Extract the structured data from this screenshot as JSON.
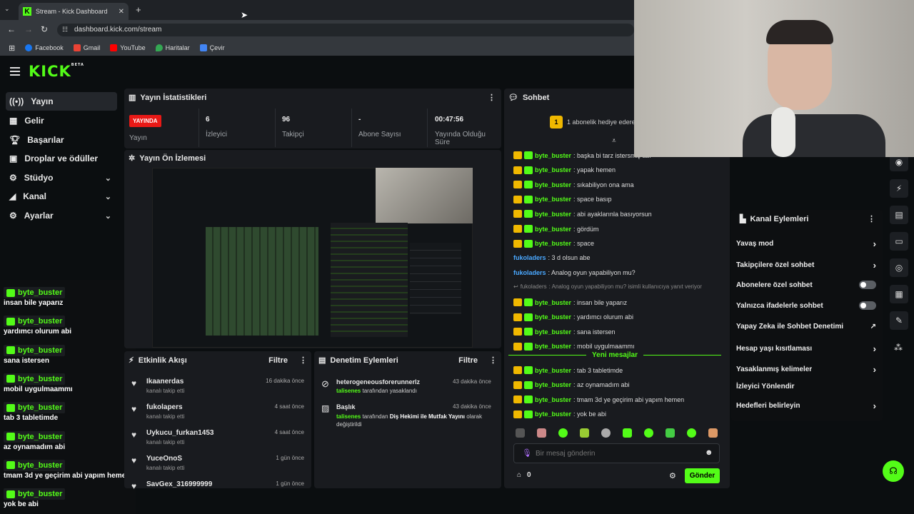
{
  "browser": {
    "tab_title": "Stream - Kick Dashboard",
    "url": "dashboard.kick.com/stream",
    "bookmarks": [
      "Facebook",
      "Gmail",
      "YouTube",
      "Haritalar",
      "Çevir"
    ]
  },
  "brand": {
    "logo": "KICK",
    "beta": "BETA"
  },
  "sidebar": {
    "items": [
      {
        "label": "Yayın"
      },
      {
        "label": "Gelir"
      },
      {
        "label": "Başarılar"
      },
      {
        "label": "Droplar ve ödüller"
      },
      {
        "label": "Stüdyo"
      },
      {
        "label": "Kanal"
      },
      {
        "label": "Ayarlar"
      }
    ]
  },
  "stats": {
    "title": "Yayın İstatistikleri",
    "live_badge": "YAYINDA",
    "live_label": "Yayın",
    "viewers_value": "6",
    "viewers_label": "İzleyici",
    "followers_value": "96",
    "followers_label": "Takipçi",
    "subs_value": "-",
    "subs_label": "Abone Sayısı",
    "duration_value": "00:47:56",
    "duration_label": "Yayında Olduğu Süre"
  },
  "preview": {
    "title": "Yayın Ön İzlemesi"
  },
  "activity": {
    "title": "Etkinlik Akışı",
    "filter": "Filtre",
    "rows": [
      {
        "name": "Ikaanerdas",
        "sub": "kanalı takip etti",
        "time": "16 dakika önce"
      },
      {
        "name": "fukolapers",
        "sub": "kanalı takip etti",
        "time": "4 saat önce"
      },
      {
        "name": "Uykucu_furkan1453",
        "sub": "kanalı takip etti",
        "time": "4 saat önce"
      },
      {
        "name": "YuceOnoS",
        "sub": "kanalı takip etti",
        "time": "1 gün önce"
      },
      {
        "name": "SavGex_316999999",
        "sub": "",
        "time": "1 gün önce"
      }
    ]
  },
  "moderation": {
    "title": "Denetim Eylemleri",
    "filter": "Filtre",
    "rows": [
      {
        "name": "heterogeneousforerunnerlz",
        "actor": "talisenes",
        "text": "tarafından yasaklandı",
        "time": "43 dakika önce"
      },
      {
        "name": "Başlık",
        "actor": "talisenes",
        "text": "tarafından",
        "highlight": "Diş Hekimi ile Mutfak Yayını",
        "text2": "olarak değiştirildi",
        "time": "43 dakika önce"
      }
    ]
  },
  "chat": {
    "title": "Sohbet",
    "gift_text": "1 abonelik hediye ederek",
    "messages": [
      {
        "user": "byte_buster",
        "text": ": başka bi tarz istersmiş abi"
      },
      {
        "user": "byte_buster",
        "text": ": yapak hemen"
      },
      {
        "user": "byte_buster",
        "text": ": sıkabiliyon ona ama"
      },
      {
        "user": "byte_buster",
        "text": ": space basıp"
      },
      {
        "user": "byte_buster",
        "text": ": abi ayaklarınla basıyorsun"
      },
      {
        "user": "byte_buster",
        "text": ": gördüm"
      },
      {
        "user": "byte_buster",
        "text": ": space"
      },
      {
        "user": "fukoladers",
        "text": ": 3 d olsun abe"
      },
      {
        "user": "fukoladers",
        "text": ": Analog oyun yapabiliyon mu?"
      },
      {
        "user": "fukoladers",
        "text": ": Analog oyun yapabiliyon mu? isimli kullanıcıya yanıt veriyor"
      },
      {
        "user": "byte_buster",
        "text": ": insan bile yaparız"
      },
      {
        "user": "byte_buster",
        "text": ": yardımcı olurum abi"
      },
      {
        "user": "byte_buster",
        "text": ": sana istersen"
      },
      {
        "user": "byte_buster",
        "text": ": mobil uygulmaammı"
      }
    ],
    "new_messages": "Yeni mesajlar",
    "new": [
      {
        "user": "byte_buster",
        "text": ": tab 3 tabletimde"
      },
      {
        "user": "byte_buster",
        "text": ": az oynamadım abi"
      },
      {
        "user": "byte_buster",
        "text": ": tmam 3d ye geçirim abi yapım hemen"
      },
      {
        "user": "byte_buster",
        "text": ": yok be abi"
      }
    ],
    "input_placeholder": "Bir mesaj gönderin",
    "points": "0",
    "send": "Gönder"
  },
  "channel_actions": {
    "title": "Kanal Eylemleri",
    "items": [
      {
        "label": "Yavaş mod",
        "kind": "chevron"
      },
      {
        "label": "Takipçilere özel sohbet",
        "kind": "chevron"
      },
      {
        "label": "Abonelere özel sohbet",
        "kind": "toggle"
      },
      {
        "label": "Yalnızca ifadelerle sohbet",
        "kind": "toggle"
      },
      {
        "label": "Yapay Zeka ile Sohbet Denetimi",
        "kind": "external"
      },
      {
        "label": "Hesap yaşı kısıtlaması",
        "kind": "chevron"
      },
      {
        "label": "Yasaklanmış kelimeler",
        "kind": "chevron"
      },
      {
        "label": "İzleyici Yönlendir",
        "kind": "none"
      },
      {
        "label": "Hedefleri belirleyin",
        "kind": "chevron"
      }
    ]
  },
  "overlay": {
    "messages": [
      {
        "user": "byte_buster",
        "text": "insan bile yaparız"
      },
      {
        "user": "byte_buster",
        "text": "yardımcı olurum abi"
      },
      {
        "user": "byte_buster",
        "text": "sana istersen"
      },
      {
        "user": "byte_buster",
        "text": "mobil uygulmaammı"
      },
      {
        "user": "byte_buster",
        "text": "tab 3 tabletimde"
      },
      {
        "user": "byte_buster",
        "text": "az oynamadım abi"
      },
      {
        "user": "byte_buster",
        "text": "tmam 3d ye geçirim abi yapım hemen"
      },
      {
        "user": "byte_buster",
        "text": "yok be abi"
      }
    ]
  }
}
